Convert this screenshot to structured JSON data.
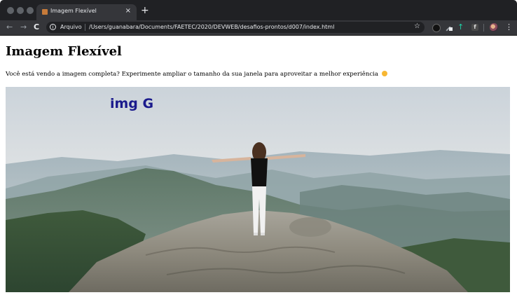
{
  "browser": {
    "tab_title": "Imagem Flexível",
    "tab_close": "×",
    "new_tab": "+",
    "nav_back": "←",
    "nav_forward": "→",
    "nav_reload": "C",
    "info_icon": "i",
    "url_scheme": "Arquivo",
    "url": "/Users/guanabara/Documents/FAETEC/2020/DEVWEB/desafios-prontos/d007/index.html",
    "star": "☆",
    "kebab": "⋮",
    "ext_trend": "↑",
    "ext_f": "f"
  },
  "page": {
    "heading": "Imagem Flexível",
    "intro": "Você está vendo a imagem completa? Experimente ampliar o tamanho da sua janela para aproveitar a melhor experiência",
    "image_label": "img G"
  }
}
